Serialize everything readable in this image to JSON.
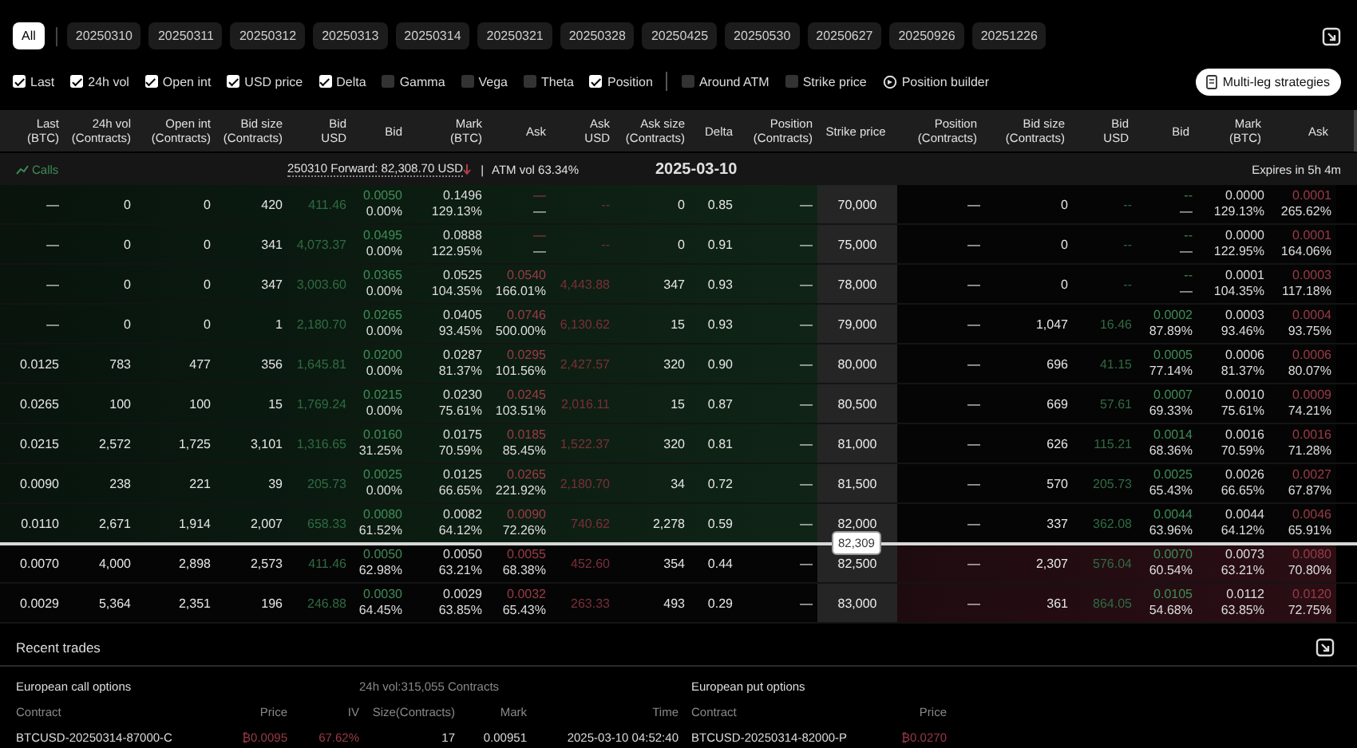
{
  "expiry_tabs": [
    {
      "label": "All",
      "selected": true
    },
    {
      "label": "20250310",
      "selected": false
    },
    {
      "label": "20250311",
      "selected": false
    },
    {
      "label": "20250312",
      "selected": false
    },
    {
      "label": "20250313",
      "selected": false
    },
    {
      "label": "20250314",
      "selected": false
    },
    {
      "label": "20250321",
      "selected": false
    },
    {
      "label": "20250328",
      "selected": false
    },
    {
      "label": "20250425",
      "selected": false
    },
    {
      "label": "20250530",
      "selected": false
    },
    {
      "label": "20250627",
      "selected": false
    },
    {
      "label": "20250926",
      "selected": false
    },
    {
      "label": "20251226",
      "selected": false
    }
  ],
  "column_toggles": [
    {
      "label": "Last",
      "checked": true
    },
    {
      "label": "24h vol",
      "checked": true
    },
    {
      "label": "Open int",
      "checked": true
    },
    {
      "label": "USD price",
      "checked": true
    },
    {
      "label": "Delta",
      "checked": true
    },
    {
      "label": "Gamma",
      "checked": false
    },
    {
      "label": "Vega",
      "checked": false
    },
    {
      "label": "Theta",
      "checked": false
    },
    {
      "label": "Position",
      "checked": true
    }
  ],
  "view_toggles": [
    {
      "kind": "checkbox",
      "label": "Around ATM",
      "checked": false
    },
    {
      "kind": "checkbox",
      "label": "Strike price",
      "checked": false
    },
    {
      "kind": "builder",
      "label": "Position builder"
    }
  ],
  "multi_leg_button": "Multi-leg strategies",
  "columns": {
    "calls": [
      {
        "label": "Last",
        "unit": "(BTC)"
      },
      {
        "label": "24h vol",
        "unit": "(Contracts)"
      },
      {
        "label": "Open int",
        "unit": "(Contracts)"
      },
      {
        "label": "Bid size",
        "unit": "(Contracts)"
      },
      {
        "label": "Bid",
        "unit": "USD"
      },
      {
        "label": "Bid"
      },
      {
        "label": "Mark",
        "unit": "(BTC)"
      },
      {
        "label": "Ask"
      },
      {
        "label": "Ask",
        "unit": "USD"
      },
      {
        "label": "Ask size",
        "unit": "(Contracts)"
      },
      {
        "label": "Delta"
      },
      {
        "label": "Position",
        "unit": "(Contracts)"
      }
    ],
    "strike": {
      "label": "Strike price"
    },
    "puts": [
      {
        "label": "Position",
        "unit": "(Contracts)"
      },
      {
        "label": "Bid size",
        "unit": "(Contracts)"
      },
      {
        "label": "Bid",
        "unit": "USD"
      },
      {
        "label": "Bid"
      },
      {
        "label": "Mark",
        "unit": "(BTC)"
      },
      {
        "label": "Ask"
      }
    ]
  },
  "info_bar": {
    "calls_label": "Calls",
    "forward": "250310 Forward: 82,308.70 USD",
    "separator": "|",
    "atm_vol": "ATM vol 63.34%",
    "expiry_date": "2025-03-10",
    "expires_in": "Expires in 5h 4m"
  },
  "rows": [
    {
      "kind": "strike",
      "call_itm": true,
      "put_itm": false,
      "call": [
        "—",
        "0",
        "0",
        "420",
        "411.46",
        [
          "0.0050",
          "0.00%"
        ],
        [
          "0.1496",
          "129.13%"
        ],
        [
          "—",
          "—"
        ],
        "--",
        "0",
        "0.85",
        "—"
      ],
      "strike": "70,000",
      "put": [
        "—",
        "0",
        "--",
        [
          "--",
          "—"
        ],
        [
          "0.0000",
          "129.13%"
        ],
        [
          "0.0001",
          "265.62%"
        ]
      ]
    },
    {
      "kind": "strike",
      "call_itm": true,
      "put_itm": false,
      "call": [
        "—",
        "0",
        "0",
        "341",
        "4,073.37",
        [
          "0.0495",
          "0.00%"
        ],
        [
          "0.0888",
          "122.95%"
        ],
        [
          "—",
          "—"
        ],
        "--",
        "0",
        "0.91",
        "—"
      ],
      "strike": "75,000",
      "put": [
        "—",
        "0",
        "--",
        [
          "--",
          "—"
        ],
        [
          "0.0000",
          "122.95%"
        ],
        [
          "0.0001",
          "164.06%"
        ]
      ]
    },
    {
      "kind": "strike",
      "call_itm": true,
      "put_itm": false,
      "call": [
        "—",
        "0",
        "0",
        "347",
        "3,003.60",
        [
          "0.0365",
          "0.00%"
        ],
        [
          "0.0525",
          "104.35%"
        ],
        [
          "0.0540",
          "166.01%"
        ],
        "4,443.88",
        "347",
        "0.93",
        "—"
      ],
      "strike": "78,000",
      "put": [
        "—",
        "0",
        "--",
        [
          "--",
          "—"
        ],
        [
          "0.0001",
          "104.35%"
        ],
        [
          "0.0003",
          "117.18%"
        ]
      ]
    },
    {
      "kind": "strike",
      "call_itm": true,
      "put_itm": false,
      "call": [
        "—",
        "0",
        "0",
        "1",
        "2,180.70",
        [
          "0.0265",
          "0.00%"
        ],
        [
          "0.0405",
          "93.45%"
        ],
        [
          "0.0746",
          "500.00%"
        ],
        "6,130.62",
        "15",
        "0.93",
        "—"
      ],
      "strike": "79,000",
      "put": [
        "—",
        "1,047",
        "16.46",
        [
          "0.0002",
          "87.89%"
        ],
        [
          "0.0003",
          "93.46%"
        ],
        [
          "0.0004",
          "93.75%"
        ]
      ]
    },
    {
      "kind": "strike",
      "call_itm": true,
      "put_itm": false,
      "call": [
        "0.0125",
        "783",
        "477",
        "356",
        "1,645.81",
        [
          "0.0200",
          "0.00%"
        ],
        [
          "0.0287",
          "81.37%"
        ],
        [
          "0.0295",
          "101.56%"
        ],
        "2,427.57",
        "320",
        "0.90",
        "—"
      ],
      "strike": "80,000",
      "put": [
        "—",
        "696",
        "41.15",
        [
          "0.0005",
          "77.14%"
        ],
        [
          "0.0006",
          "81.37%"
        ],
        [
          "0.0006",
          "80.07%"
        ]
      ]
    },
    {
      "kind": "strike",
      "call_itm": true,
      "put_itm": false,
      "call": [
        "0.0265",
        "100",
        "100",
        "15",
        "1,769.24",
        [
          "0.0215",
          "0.00%"
        ],
        [
          "0.0230",
          "75.61%"
        ],
        [
          "0.0245",
          "103.51%"
        ],
        "2,016.11",
        "15",
        "0.87",
        "—"
      ],
      "strike": "80,500",
      "put": [
        "—",
        "669",
        "57.61",
        [
          "0.0007",
          "69.33%"
        ],
        [
          "0.0010",
          "75.61%"
        ],
        [
          "0.0009",
          "74.21%"
        ]
      ]
    },
    {
      "kind": "strike",
      "call_itm": true,
      "put_itm": false,
      "call": [
        "0.0215",
        "2,572",
        "1,725",
        "3,101",
        "1,316.65",
        [
          "0.0160",
          "31.25%"
        ],
        [
          "0.0175",
          "70.59%"
        ],
        [
          "0.0185",
          "85.45%"
        ],
        "1,522.37",
        "320",
        "0.81",
        "—"
      ],
      "strike": "81,000",
      "put": [
        "—",
        "626",
        "115.21",
        [
          "0.0014",
          "68.36%"
        ],
        [
          "0.0016",
          "70.59%"
        ],
        [
          "0.0016",
          "71.28%"
        ]
      ]
    },
    {
      "kind": "strike",
      "call_itm": true,
      "put_itm": false,
      "call": [
        "0.0090",
        "238",
        "221",
        "39",
        "205.73",
        [
          "0.0025",
          "0.00%"
        ],
        [
          "0.0125",
          "66.65%"
        ],
        [
          "0.0265",
          "221.92%"
        ],
        "2,180.70",
        "34",
        "0.72",
        "—"
      ],
      "strike": "81,500",
      "put": [
        "—",
        "570",
        "205.73",
        [
          "0.0025",
          "65.43%"
        ],
        [
          "0.0026",
          "66.65%"
        ],
        [
          "0.0027",
          "67.87%"
        ]
      ]
    },
    {
      "kind": "strike",
      "call_itm": true,
      "put_itm": false,
      "call": [
        "0.0110",
        "2,671",
        "1,914",
        "2,007",
        "658.33",
        [
          "0.0080",
          "61.52%"
        ],
        [
          "0.0082",
          "64.12%"
        ],
        [
          "0.0090",
          "72.26%"
        ],
        "740.62",
        "2,278",
        "0.59",
        "—"
      ],
      "strike": "82,000",
      "put": [
        "—",
        "337",
        "362.08",
        [
          "0.0044",
          "63.96%"
        ],
        [
          "0.0044",
          "64.12%"
        ],
        [
          "0.0046",
          "65.91%"
        ]
      ]
    },
    {
      "kind": "marker",
      "label": "82,309"
    },
    {
      "kind": "strike",
      "call_itm": false,
      "put_itm": true,
      "call": [
        "0.0070",
        "4,000",
        "2,898",
        "2,573",
        "411.46",
        [
          "0.0050",
          "62.98%"
        ],
        [
          "0.0050",
          "63.21%"
        ],
        [
          "0.0055",
          "68.38%"
        ],
        "452.60",
        "354",
        "0.44",
        "—"
      ],
      "strike": "82,500",
      "put": [
        "—",
        "2,307",
        "576.04",
        [
          "0.0070",
          "60.54%"
        ],
        [
          "0.0073",
          "63.21%"
        ],
        [
          "0.0080",
          "70.80%"
        ]
      ]
    },
    {
      "kind": "strike",
      "call_itm": false,
      "put_itm": true,
      "call": [
        "0.0029",
        "5,364",
        "2,351",
        "196",
        "246.88",
        [
          "0.0030",
          "64.45%"
        ],
        [
          "0.0029",
          "63.85%"
        ],
        [
          "0.0032",
          "65.43%"
        ],
        "263.33",
        "493",
        "0.29",
        "—"
      ],
      "strike": "83,000",
      "put": [
        "—",
        "361",
        "864.05",
        [
          "0.0105",
          "54.68%"
        ],
        [
          "0.0112",
          "63.85%"
        ],
        [
          "0.0120",
          "72.75%"
        ]
      ]
    }
  ],
  "recent_trades": {
    "title": "Recent trades",
    "calls": {
      "title": "European call options",
      "volume": "24h vol:315,055 Contracts",
      "columns": [
        "Contract",
        "Price",
        "IV",
        "Size(Contracts)",
        "Mark",
        "Time"
      ],
      "rows": [
        [
          "BTCUSD-20250314-87000-C",
          "₿0.0095",
          "67.62%",
          "17",
          "0.00951",
          "2025-03-10 04:52:40"
        ]
      ]
    },
    "puts": {
      "title": "European put options",
      "columns": [
        "Contract",
        "Price"
      ],
      "rows": [
        [
          "BTCUSD-20250314-82000-P",
          "₿0.0270"
        ]
      ]
    }
  }
}
